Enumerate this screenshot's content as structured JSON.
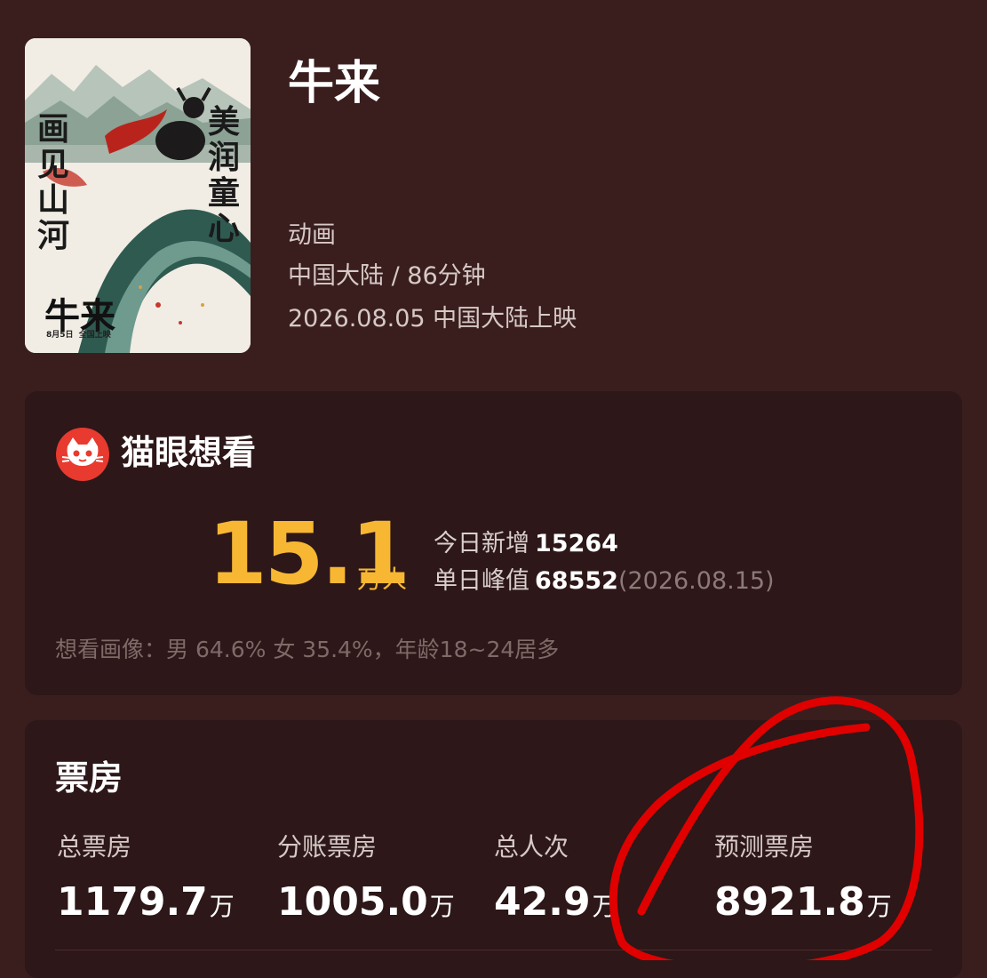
{
  "movie": {
    "title": "牛来",
    "genre": "动画",
    "region_duration": "中国大陆 / 86分钟",
    "release": "2026.08.05 中国大陆上映"
  },
  "poster": {
    "left_slogan": "画见山河",
    "right_slogan": "美润童心",
    "title": "牛来",
    "date_line": "8月5日  全国上映"
  },
  "want": {
    "title": "猫眼想看",
    "count": "15.1",
    "unit": "万人",
    "new_label": "今日新增",
    "new_value": "15264",
    "peak_label": "单日峰值",
    "peak_value": "68552",
    "peak_date": "(2026.08.15)",
    "portrait": "想看画像：男 64.6% 女 35.4%，年龄18~24居多"
  },
  "box_office": {
    "title": "票房",
    "items": [
      {
        "label": "总票房",
        "value": "1179.7",
        "unit": "万"
      },
      {
        "label": "分账票房",
        "value": "1005.0",
        "unit": "万"
      },
      {
        "label": "总人次",
        "value": "42.9",
        "unit": "万"
      },
      {
        "label": "预测票房",
        "value": "8921.8",
        "unit": "万"
      }
    ]
  },
  "colors": {
    "background": "#3a1e1e",
    "card": "#2d1718",
    "accent": "#f7b733",
    "annotation": "#e00000",
    "maoyan_red": "#e83a2f"
  }
}
